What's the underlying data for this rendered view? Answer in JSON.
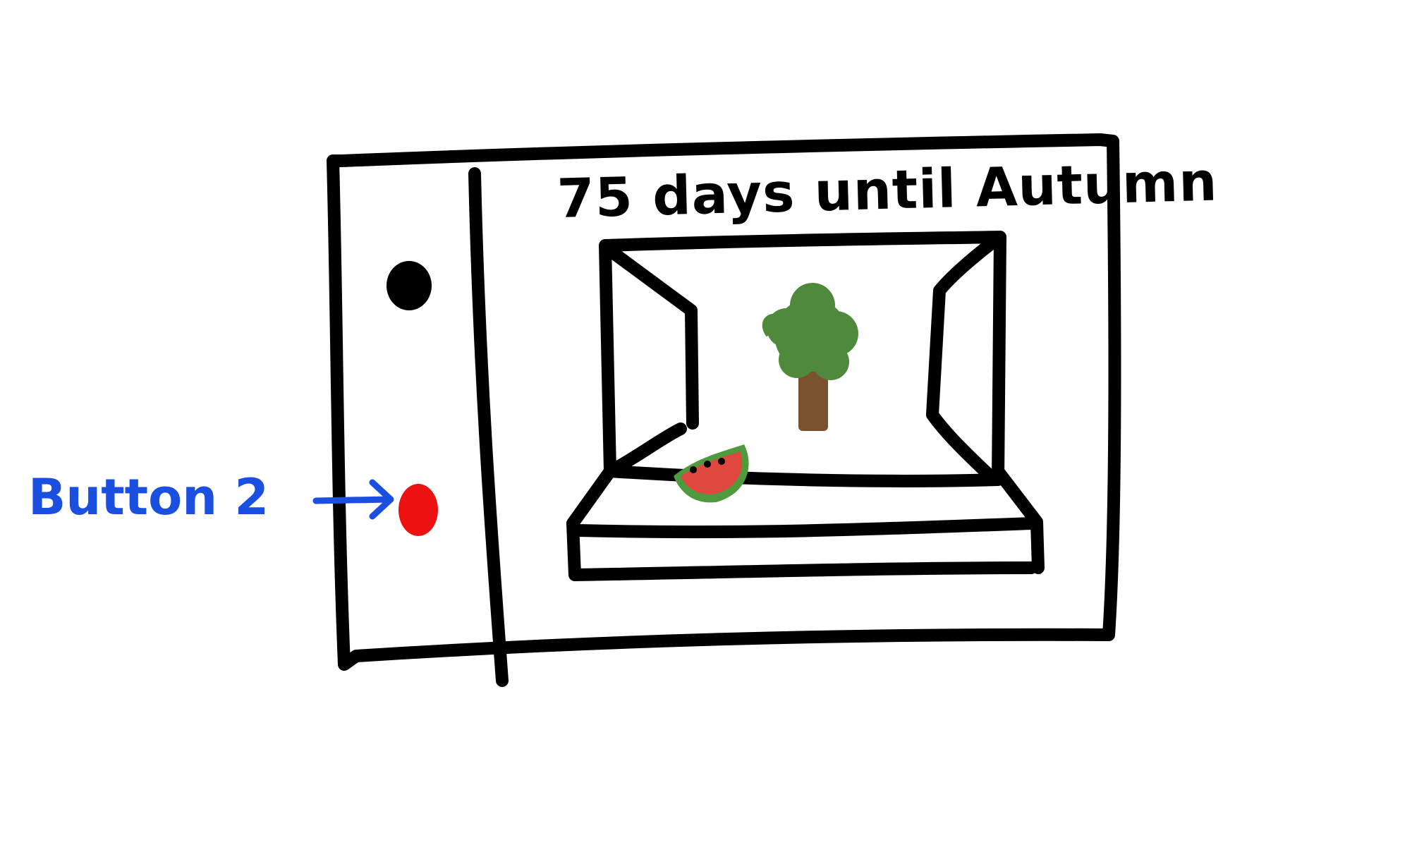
{
  "screen": {
    "title": "75 days until Autumn"
  },
  "annotations": {
    "button_2_label": "Button 2"
  },
  "buttons": [
    {
      "color": "#000000"
    },
    {
      "color": "#ee1111"
    }
  ],
  "colors": {
    "stroke": "#000000",
    "annotation": "#1a4fe0",
    "tree_foliage": "#4f8a3c",
    "tree_trunk": "#7a5230",
    "watermelon_rind": "#4f9a3c",
    "watermelon_flesh": "#e0473f"
  },
  "icons": [
    "tree-icon",
    "watermelon-icon",
    "arrow-icon"
  ]
}
